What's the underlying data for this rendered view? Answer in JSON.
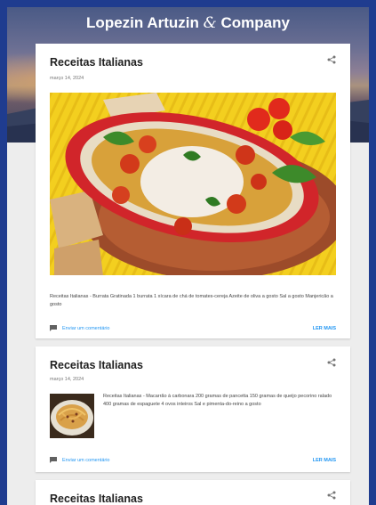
{
  "site": {
    "title_main": "Lopezin Artuzin ",
    "title_amp": "&",
    "title_end": " Company"
  },
  "posts": [
    {
      "title": "Receitas Italianas",
      "date": "março 14, 2024",
      "snippet": " Receitas Italianas - Burrata Gratinada 1 burrata 1 xícara de chá de tomates-cereja Azeite de oliva a gosto Sal a gosto Manjericão a gosto",
      "comment_label": "Enviar um comentário",
      "read_more": "LER MAIS",
      "image_icon": "burrata-dish-image"
    },
    {
      "title": "Receitas Italianas",
      "date": "março 14, 2024",
      "snippet": "  Receitas Italianas - Macarrão à carbonara  200 gramas de pancetta 150 gramas de queijo pecorino ralado 400 gramas de espaguete 4 ovos inteiros Sal e pimenta-do-reino a gosto",
      "comment_label": "Enviar um comentário",
      "read_more": "LER MAIS",
      "image_icon": "carbonara-thumbnail"
    },
    {
      "title": "Receitas Italianas"
    }
  ],
  "colors": {
    "accent": "#2196f3",
    "frame": "#1f3c8f",
    "card_bg": "#ffffff",
    "page_bg": "#ededed"
  }
}
